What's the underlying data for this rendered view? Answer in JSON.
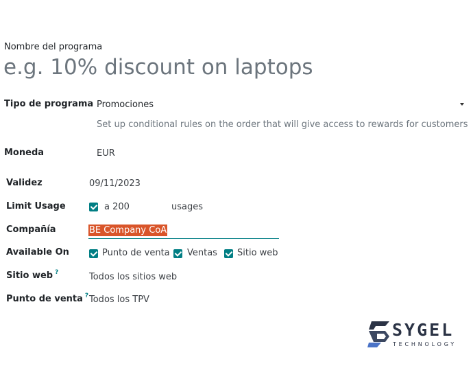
{
  "form": {
    "program_name_label": "Nombre del programa",
    "program_name_placeholder": "e.g. 10% discount on laptops",
    "program_type_label": "Tipo de programa",
    "program_type_value": "Promociones",
    "program_type_help": "Set up conditional rules on the order that will give access to rewards for customers",
    "currency_label": "Moneda",
    "currency_value": "EUR",
    "validity_label": "Validez",
    "validity_value": "09/11/2023",
    "limit_usage_label": "Limit Usage",
    "limit_usage_prefix": "a 200",
    "limit_usage_suffix": "usages",
    "company_label": "Compañía",
    "company_value": "BE Company CoA",
    "available_on_label": "Available On",
    "available_on_options": [
      "Punto de venta",
      "Ventas",
      "Sitio web"
    ],
    "website_label": "Sitio web",
    "website_value": "Todos los sitios web",
    "pos_label": "Punto de venta",
    "pos_value": "Todos los TPV",
    "help_marker": "?"
  },
  "logo": {
    "name": "SYGEL",
    "tagline": "TECHNOLOGY"
  },
  "colors": {
    "accent": "#017e84",
    "selection": "#d9552a",
    "logo_dark": "#2b3345"
  }
}
